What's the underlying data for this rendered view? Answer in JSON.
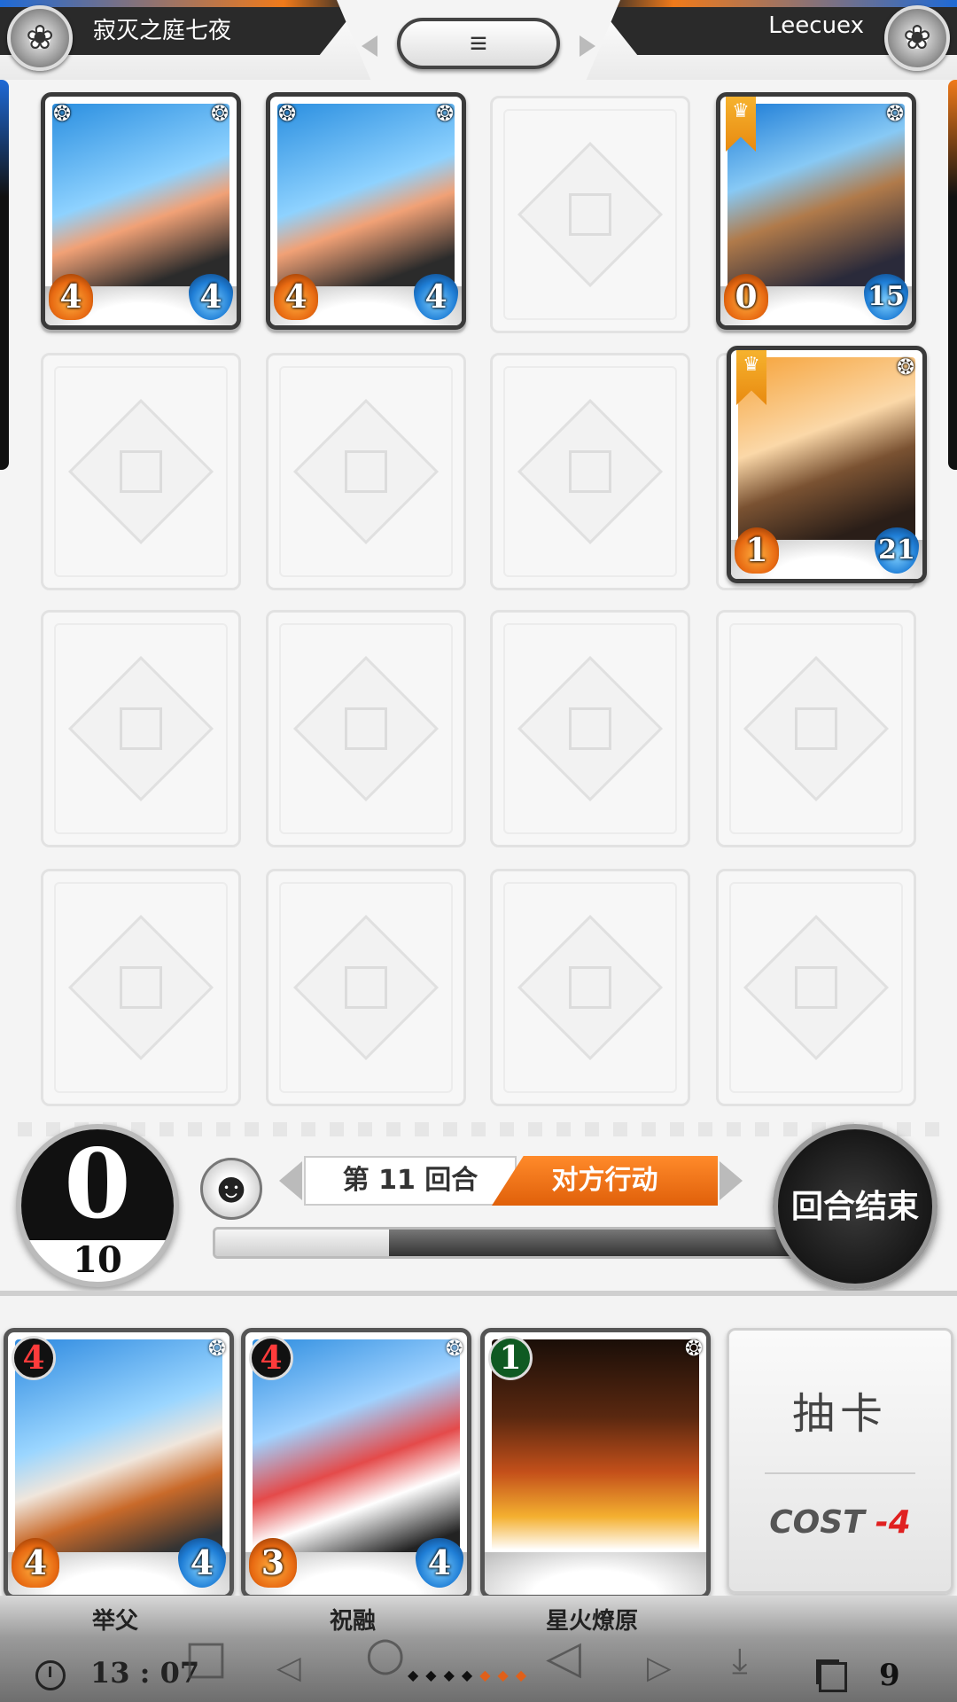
{
  "header": {
    "opponent_name": "寂灭之庭七夜",
    "player_name": "Leecuex",
    "menu_icon": "≡"
  },
  "board": {
    "cards": [
      {
        "slot": "r1c1",
        "owner": "opponent",
        "art": "art-fox",
        "atk": "4",
        "hp": "4",
        "crown": false
      },
      {
        "slot": "r1c2",
        "owner": "opponent",
        "art": "art-fox",
        "atk": "4",
        "hp": "4",
        "crown": false
      },
      {
        "slot": "r1c4",
        "owner": "opponent",
        "art": "art-ruler",
        "atk": "0",
        "hp": "15",
        "crown": true
      },
      {
        "slot": "r2c4",
        "owner": "opponent",
        "art": "art-bard",
        "atk": "1",
        "hp": "21",
        "crown": true
      }
    ]
  },
  "controls": {
    "mana_current": "0",
    "mana_max": "10",
    "emote_icon": "☻",
    "turn_label": "第 11 回合",
    "phase_label": "对方行动",
    "timer_remaining_fraction": 0.3,
    "end_turn_label": "回合结束"
  },
  "hand": {
    "cards": [
      {
        "name": "举父",
        "cost": "4",
        "atk": "4",
        "hp": "4",
        "art": "art-tiger",
        "cost_style": "red"
      },
      {
        "name": "祝融",
        "cost": "4",
        "atk": "3",
        "hp": "4",
        "art": "art-red",
        "cost_style": "red"
      },
      {
        "name": "星火燎原",
        "cost": "1",
        "atk": "",
        "hp": "",
        "art": "art-fire",
        "cost_style": "green"
      }
    ],
    "draw": {
      "label": "抽卡",
      "cost_word": "COST",
      "cost_value": "-4"
    }
  },
  "system_bar": {
    "clock": "13 : 07",
    "hand_count": "9"
  },
  "colors": {
    "accent_orange": "#e0600a",
    "accent_blue": "#1f6ad6",
    "cost_red": "#e02020"
  }
}
